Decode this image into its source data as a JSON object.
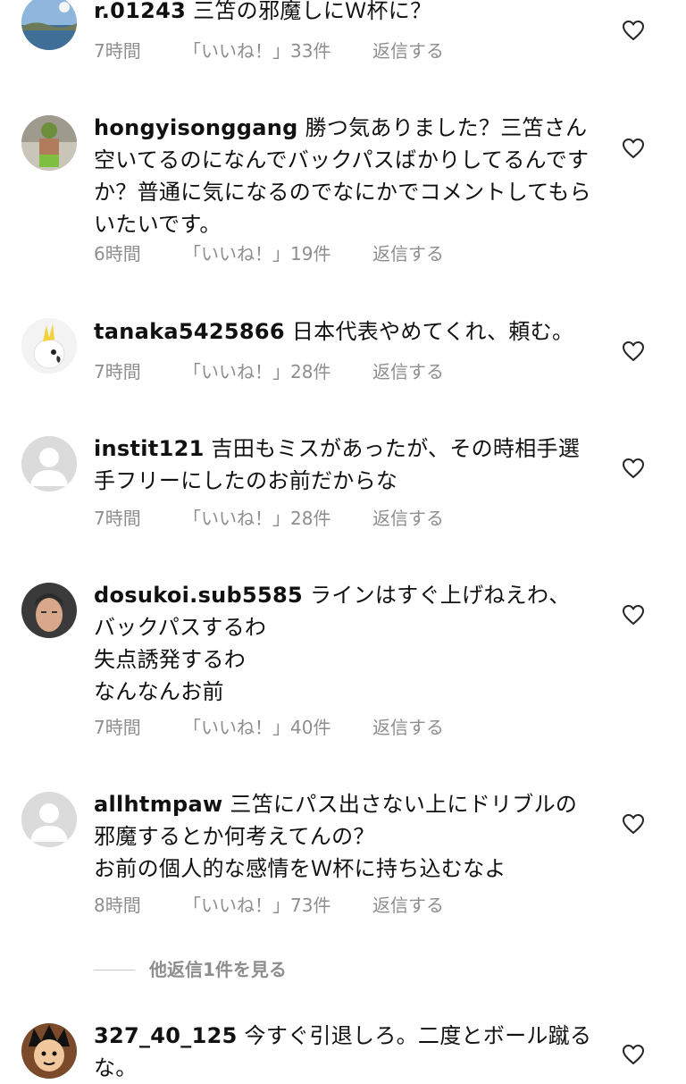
{
  "comments": [
    {
      "username": "r.01243",
      "text": "三笘の邪魔しにＷ杯に？",
      "time": "7時間",
      "likes": "「いいね！」33件",
      "reply": "返信する",
      "avatar": "seascape-photo"
    },
    {
      "username": "hongyisonggang",
      "text": "勝つ気ありました？三笘さん空いてるのになんでバックパスばかりしてるんですか？普通に気になるのでなにかでコメントしてもらいたいです。",
      "time": "6時間",
      "likes": "「いいね！」19件",
      "reply": "返信する",
      "avatar": "person-photo"
    },
    {
      "username": "tanaka5425866",
      "text": "日本代表やめてくれ、頼む。",
      "time": "7時間",
      "likes": "「いいね！」28件",
      "reply": "返信する",
      "avatar": "cockatoo-photo"
    },
    {
      "username": "instit121",
      "text": "吉田もミスがあったが、その時相手選手フリーにしたのお前だからな",
      "time": "7時間",
      "likes": "「いいね！」28件",
      "reply": "返信する",
      "avatar": "default-user-icon"
    },
    {
      "username": "dosukoi.sub5585",
      "text": "ラインはすぐ上げねえわ、\nバックパスするわ\n失点誘発するわ\nなんなんお前",
      "time": "7時間",
      "likes": "「いいね！」40件",
      "reply": "返信する",
      "avatar": "face-photo"
    },
    {
      "username": "allhtmpaw",
      "text": "三笘にパス出さない上にドリブルの邪魔するとか何考えてんの？\nお前の個人的な感情をＷ杯に持ち込むなよ",
      "time": "8時間",
      "likes": "「いいね！」73件",
      "reply": "返信する",
      "avatar": "default-user-icon"
    },
    {
      "username": "327_40_125",
      "text": "今すぐ引退しろ。二度とボール蹴るな。",
      "avatar": "cartoon-avatar"
    }
  ],
  "view_replies": "他返信1件を見る",
  "colors": {
    "text": "#111111",
    "meta": "#8e8e8e",
    "divider": "#c7c7c7",
    "background": "#ffffff"
  },
  "icons": {
    "like": "heart-outline-icon"
  }
}
